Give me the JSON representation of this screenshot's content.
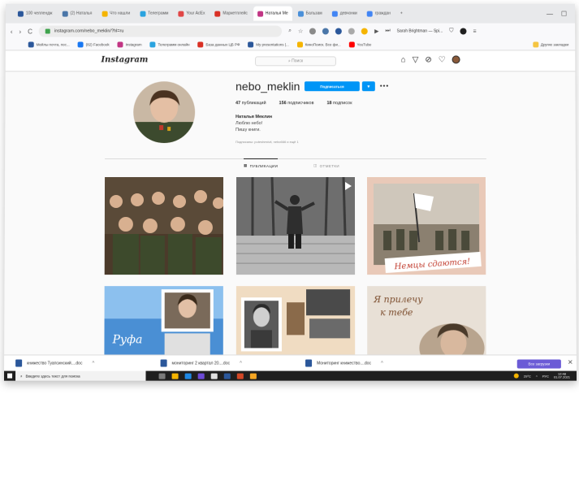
{
  "browser": {
    "tabs": [
      {
        "label": "100 челлендж",
        "color": "#2b579a"
      },
      {
        "label": "(2) Наталья",
        "color": "#4a76a8"
      },
      {
        "label": "Что нашли",
        "color": "#f5b400"
      },
      {
        "label": "Телеграмм",
        "color": "#2aa3df"
      },
      {
        "label": "Your AdEx",
        "color": "#e04646"
      },
      {
        "label": "Маркетплейс",
        "color": "#d93025"
      },
      {
        "label": "Наталья Ме",
        "color": "#c13584",
        "active": true
      },
      {
        "label": "Бальзам",
        "color": "#4a90d9"
      },
      {
        "label": "девчонки",
        "color": "#4285f4"
      },
      {
        "label": "граждан",
        "color": "#4285f4"
      }
    ],
    "url": "instagram.com/nebo_meklin/?hl=ru",
    "profile_name": "Sarah Brightman — Spi...",
    "bookmarks": [
      {
        "label": "Мейлы почта, пос...",
        "color": "#2b579a"
      },
      {
        "label": "(82) Facebook",
        "color": "#1877f2"
      },
      {
        "label": "Instagram",
        "color": "#c13584"
      },
      {
        "label": "Телеграмм онлайн",
        "color": "#2aa3df"
      },
      {
        "label": "База данных ЦБ РФ",
        "color": "#d93025"
      },
      {
        "label": "My presentations |...",
        "color": "#2b579a"
      },
      {
        "label": "КиноПоиск. Все фи...",
        "color": "#f5b400"
      },
      {
        "label": "YouTube",
        "color": "#ff0000"
      }
    ],
    "bookmarks_other": "Другие закладки"
  },
  "instagram": {
    "logo": "Instagram",
    "search_placeholder": "Поиск",
    "username": "nebo_meklin",
    "follow_label": "Подписаться",
    "stats": {
      "posts_count": "47",
      "posts_label": "публикаций",
      "followers_count": "156",
      "followers_label": "подписчиков",
      "following_count": "18",
      "following_label": "подписок"
    },
    "full_name": "Наталья Меклин",
    "bio_line1": "Люблю небо!",
    "bio_line2": "Пишу книги.",
    "followed_by": "Подписаны: puteshestvii, nebo666 и ещё 1",
    "tab_posts": "ПУБЛИКАЦИИ",
    "tab_tagged": "ОТМЕТКИ",
    "post_captions": {
      "post3": "Немцы сдаются!",
      "post4": "Руфа",
      "post6_line1": "Я прилечу",
      "post6_line2": "к тебе"
    }
  },
  "downloads": {
    "items": [
      "книжество Туапсинский....doc",
      "мониторинг 2 квартал 20....doc",
      "Мониторинг книжество....doc"
    ],
    "show_all": "Все загрузки"
  },
  "taskbar": {
    "search_placeholder": "Введите здесь текст для поиска",
    "weather": "29°C",
    "lang": "РУС",
    "time": "12:48",
    "date": "01.07.2021",
    "apps": [
      "#7a7a7a",
      "#f5b400",
      "#1e88e5",
      "#6c4ad6",
      "#e0e0e0",
      "#2b579a",
      "#d24726",
      "#f5a623"
    ]
  }
}
